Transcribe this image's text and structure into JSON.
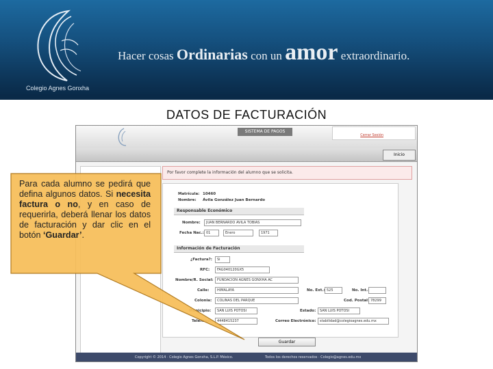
{
  "header": {
    "school_name": "Colegio Agnes Gonxha",
    "tagline": {
      "part1": "Hacer cosas ",
      "part2": "Ordinarias",
      "part3": " con un ",
      "part4": "amor",
      "part5": " extraordinario."
    }
  },
  "title": "DATOS DE FACTURACIÓN",
  "screenshot": {
    "system_label": "SISTEMA DE PAGOS",
    "session_link": "Cerrar Sesión",
    "nav_button": "Inicio",
    "notice": "Por favor complete la información del alumno que se solicita.",
    "student": {
      "matricula_label": "Matrícula:",
      "matricula_value": "10460",
      "nombre_label": "Nombre:",
      "nombre_value": "Ávila González Juan Bernardo"
    },
    "responsable_section": "Responsable Económico",
    "responsable": {
      "nombre_label": "Nombre:",
      "nombre_value": "JUAN BERNARDO AVILA TOBIAS",
      "fecha_label": "Fecha Nac.:",
      "fecha_day": "01",
      "fecha_month": "Enero",
      "fecha_year": "1971"
    },
    "facturacion_section": "Información de Facturación",
    "facturacion": {
      "factura_label": "¿Factura?:",
      "factura_value": "Si",
      "rfc_label": "RFC:",
      "rfc_value": "FAG040120GX5",
      "razon_label": "Nombre/R. Social:",
      "razon_value": "FUNDACION AGNES GONXHA AC",
      "calle_label": "Calle:",
      "calle_value": "HIMALAYA",
      "ext_label": "No. Ext.:",
      "ext_value": "525",
      "int_label": "No. Int.:",
      "int_value": "",
      "colonia_label": "Colonia:",
      "colonia_value": "COLINAS DEL PARQUE",
      "cp_label": "Cod. Postal:",
      "cp_value": "78299",
      "municipio_label": "Municipio:",
      "municipio_value": "SAN LUIS POTOSI",
      "estado_label": "Estado:",
      "estado_value": "SAN LUIS POTOSI",
      "tel_label": "Teléfono:",
      "tel_value": "4448415237",
      "correo_label": "Correo Electrónico:",
      "correo_value": "stabilidad@colegioagnes.edu.mx"
    },
    "save_button": "Guardar",
    "footer_left": "Copyright © 2014 · Colegio Agnes Gonxha, S.L.P. México.",
    "footer_right": "Todos los derechos reservados · Colegio@agnes.edu.mx"
  },
  "callout": {
    "text1": "Para cada alumno se pedirá que defina algunos datos. Si ",
    "bold1": "necesita factura o no",
    "text2": ", y en caso de requerirla, deberá llenar los datos de facturación y dar clic en el botón ",
    "bold2": "‘Guardar’",
    "text3": "."
  },
  "colors": {
    "header_blue": "#15507e",
    "footer_navy": "#3d4a6a",
    "callout_fill": "#f6be5a",
    "callout_border": "#b07a20",
    "notice_red": "#fbeaea"
  }
}
